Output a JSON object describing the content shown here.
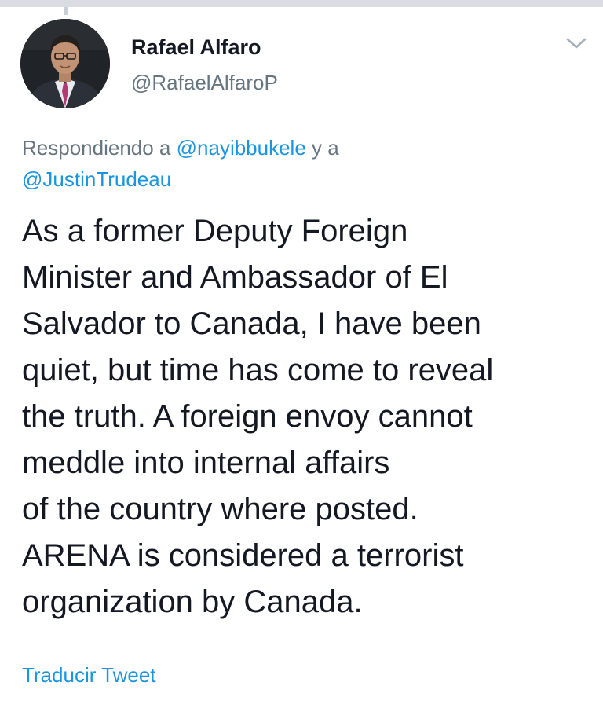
{
  "tweet": {
    "author": {
      "name": "Rafael Alfaro",
      "handle": "@RafaelAlfaroP"
    },
    "replying_to": {
      "prefix": "Respondiendo a",
      "mentions": [
        "@nayibbukele",
        "@JustinTrudeau"
      ],
      "joiner": "y a"
    },
    "text_lines": [
      "As a former Deputy Foreign",
      "Minister and Ambassador of El",
      "Salvador to Canada, I have been",
      "quiet, but time has come to reveal",
      "the truth. A foreign envoy cannot",
      "meddle into internal affairs",
      "of the country where posted.",
      "ARENA is considered a terrorist",
      "organization by Canada."
    ],
    "translate_label": "Traducir Tweet"
  },
  "colors": {
    "text": "#141823",
    "secondary": "#66757f",
    "link": "#1b95e0",
    "divider": "#d9dde2"
  },
  "icons": {
    "more": "chevron-down-icon"
  }
}
